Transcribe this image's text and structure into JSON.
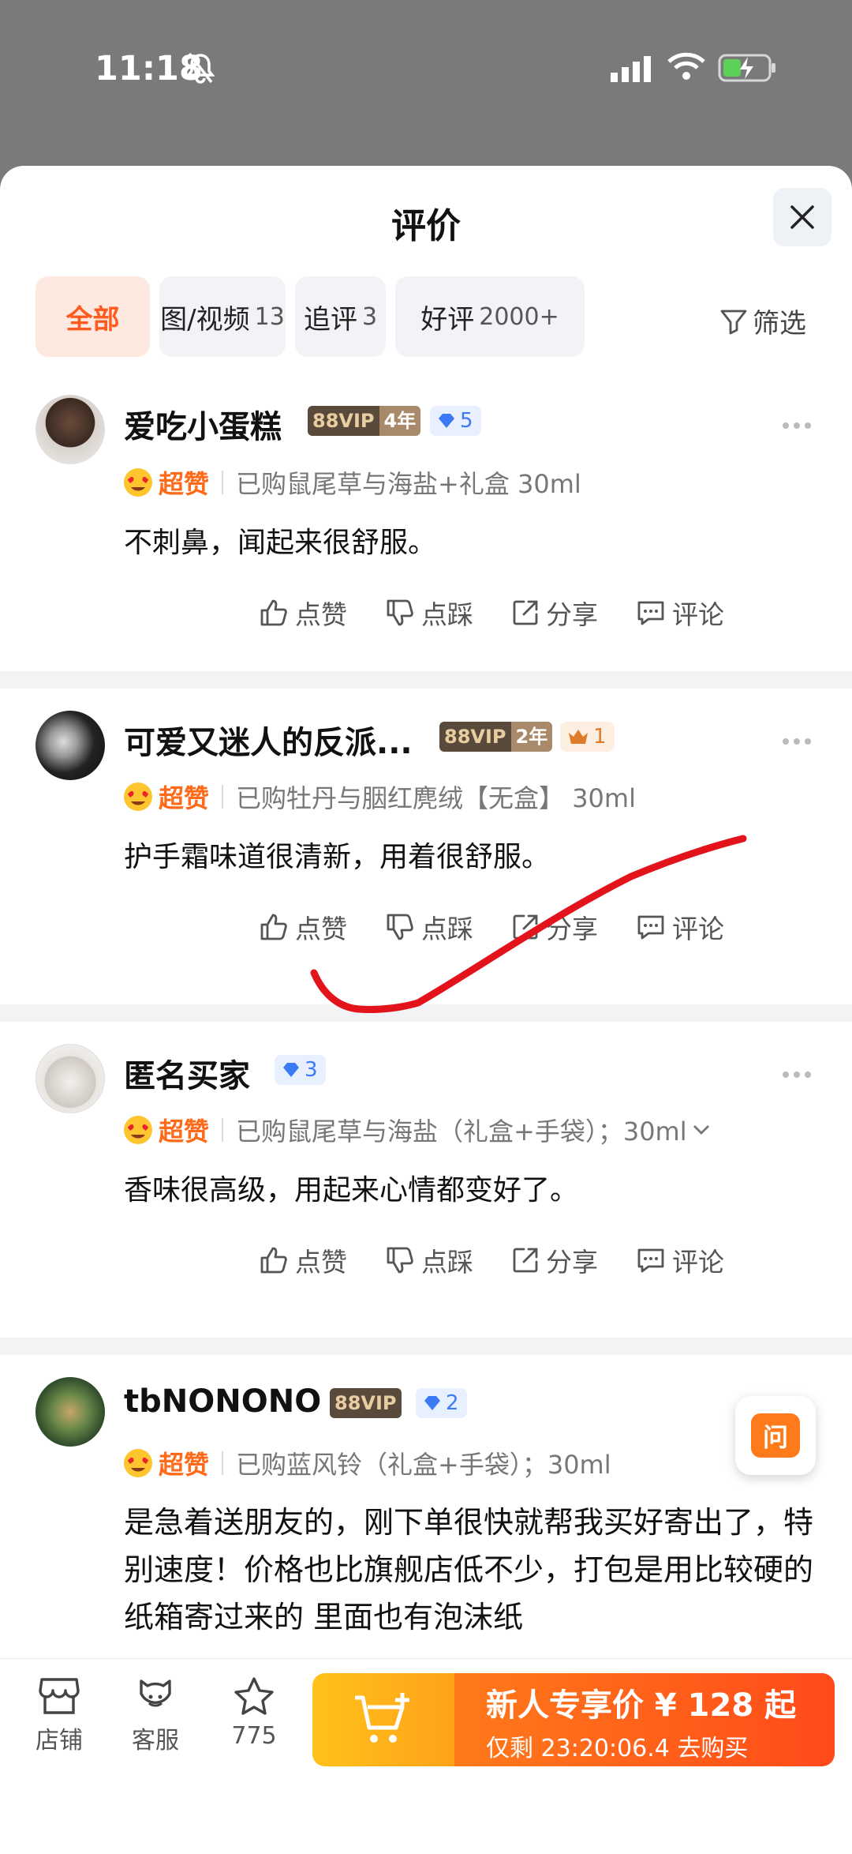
{
  "status_bar": {
    "time": "11:18"
  },
  "sheet": {
    "title": "评价"
  },
  "filters": [
    {
      "label": "全部",
      "count": ""
    },
    {
      "label": "图/视频",
      "count": "13"
    },
    {
      "label": "追评",
      "count": "3"
    },
    {
      "label": "好评",
      "count": "2000+"
    }
  ],
  "filter_button": {
    "label": "筛选"
  },
  "reviews": [
    {
      "user": "爱吃小蛋糕",
      "vip": "88VIP",
      "years": "4年",
      "level": "5",
      "rating": "超赞",
      "sku": "已购鼠尾草与海盐+礼盒 30ml",
      "content": "不刺鼻，闻起来很舒服。"
    },
    {
      "user": "可爱又迷人的反派...",
      "vip": "88VIP",
      "years": "2年",
      "level": "1",
      "rating": "超赞",
      "sku": "已购牡丹与胭红麂绒【无盒】 30ml",
      "content": "护手霜味道很清新，用着很舒服。"
    },
    {
      "user": "匿名买家",
      "vip": "",
      "years": "",
      "level": "3",
      "rating": "超赞",
      "sku": "已购鼠尾草与海盐（礼盒+手袋）；30ml",
      "content": "香味很高级，用起来心情都变好了。"
    },
    {
      "user": "tbNONONO",
      "vip": "88VIP",
      "years": "",
      "level": "2",
      "rating": "超赞",
      "sku": "已购蓝风铃（礼盒+手袋）；30ml",
      "content": "是急着送朋友的，刚下单很快就帮我买好寄出了，特别速度！价格也比旗舰店低不少，打包是用比较硬的纸箱寄过来的 里面也有泡沫纸"
    }
  ],
  "actions": {
    "like": "点赞",
    "dislike": "点踩",
    "share": "分享",
    "comment": "评论"
  },
  "ask_button": {
    "label": "问"
  },
  "bottom_bar": {
    "store": "店铺",
    "service": "客服",
    "favorites": "775",
    "buy_title": "新人专享价 ¥ 128 起",
    "buy_sub": "仅剩 23:20:06.4 去购买"
  },
  "colors": {
    "accent": "#ff5a1f",
    "annotation": "#e3131b"
  }
}
